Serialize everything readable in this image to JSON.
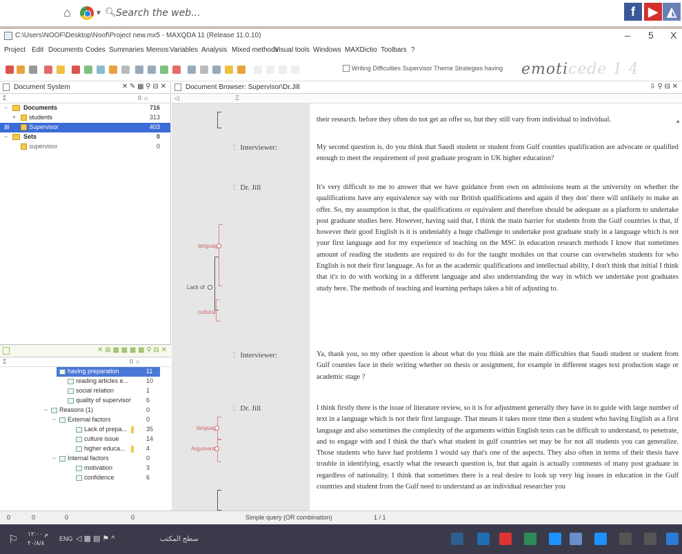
{
  "browser": {
    "search_placeholder": "Search the web..."
  },
  "window": {
    "title": "C:\\Users\\NOOF\\Desktop\\Noof\\Project new.mx5 - MAXQDA 11 (Release 11.0.10)",
    "minimize": "–",
    "restore": "5",
    "close": "X"
  },
  "menu": [
    "Project",
    "Edit",
    "Documents",
    "Codes",
    "Summaries",
    "Memos",
    "Variables",
    "Analysis",
    "Mixed methods",
    "Visual tools",
    "Windows",
    "MAXDictio",
    "Toolbars",
    "?"
  ],
  "toolbar": {
    "strategies_label": "Writing Difficulties Supervisor Theme Strategies having",
    "emoti_dark": "emoti",
    "emoti_faded": "cede 1 4"
  },
  "document_system": {
    "title": "Document System",
    "sub_left": "Σ",
    "sub_right": "0 ☼",
    "rows": [
      {
        "name": "Documents",
        "count": "716",
        "twisty": "−"
      },
      {
        "name": "students",
        "count": "313",
        "twisty": "+"
      },
      {
        "name": "Supervisor",
        "count": "403",
        "twisty": "⊞"
      },
      {
        "name": "Sets",
        "count": "0",
        "twisty": "−"
      },
      {
        "name": "supervisor",
        "count": "0",
        "twisty": ""
      }
    ]
  },
  "code_system": {
    "sub_left": "Σ",
    "sub_right": "0 ☼",
    "rows": [
      {
        "name": "having preparation",
        "count": "11",
        "twisty": ""
      },
      {
        "name": "reading articles e...",
        "count": "10",
        "twisty": ""
      },
      {
        "name": "social relation",
        "count": "1",
        "twisty": ""
      },
      {
        "name": "quality of supervisor",
        "count": "6",
        "twisty": ""
      },
      {
        "name": "Reasons (1)",
        "count": "0",
        "twisty": "−"
      },
      {
        "name": "External factors",
        "count": "0",
        "twisty": "−"
      },
      {
        "name": "Lack of prepa...",
        "count": "35",
        "twisty": ""
      },
      {
        "name": "culture issue",
        "count": "14",
        "twisty": ""
      },
      {
        "name": "higher educa...",
        "count": "4",
        "twisty": ""
      },
      {
        "name": "Internal factors",
        "count": "0",
        "twisty": "−"
      },
      {
        "name": "motivation",
        "count": "3",
        "twisty": ""
      },
      {
        "name": "confidence",
        "count": "6",
        "twisty": ""
      }
    ]
  },
  "browser_pane": {
    "title": "Document Browser: Supervisor\\Dr.Jill",
    "sub_left": "◁",
    "sub_mid": "Ξ"
  },
  "transcript": {
    "p0": "their research. before they often do not get an offer so, but they still vary from individual to individual.",
    "s1": "Interviewer:",
    "p1": "My second question is, do you think that Saudi student or student from Gulf counties qualification are advocate or qualified enough to meet the requirement of post graduate program in UK higher education?",
    "s2": "Dr. Jill",
    "p2": "It's very difficult to me to answer that we have guidance from own on admissions team at the university on whether the qualifications have any equivalence say with our British qualifications and again if they don' there will unlikely to make an offer. So, my assumption is that, the qualifications or equivalent and therefore should be adequate as a platform to undertake post graduate studies here. However, having said that, I think the main barrier for students from the Gulf countries is that, if however their good English is it is undeniably a huge challenge to undertake post graduate study in a language which is not your first language and for my experience of teaching on the MSC in education research methods I know that sometimes amount of reading the students are required to do for the taught modules on that course can overwhelm students for who English is not their first language. As for as the academic qualifications and intellectual ability, I don't think that initial I think that it's to do with working in a different language and also understanding the way in which we undertake post graduates study here. The methods of teaching and learning perhaps takes a bit of adjusting to.",
    "s3": "Interviewer:",
    "p3": "Ya, thank you, so my other question is about what do you think are the main difficulties that Saudi student or student from Gulf counties face in their writing whether on thesis or assignment, for example in different stages text production stage or academic stage ?",
    "s4": "Dr. Jill",
    "p4": "I think firstly there is the issue of literature review, so it is for adjustment generally they have in to guide with large number of text in a language which is not their first language. That means it takes more time then a student who having English as a first language and also sometimes the complexity of the arguments within English texts can be difficult to understand, to penetrate, and to engage with and I think the that's what student in gulf countries set may be for not all students you can generalize. Those students who have had problems I would say that's one of the aspects. They also often in terms of their thesis have trouble in identifying, exactly what the research question is, but that again is actually comments of many post graduate in regardless of nationality. I think that sometimes there is a real desire to look up very big issues in education in the Gulf countries and student from the Gulf need to understand as an individual researcher you",
    "code_marks": {
      "m1": "language",
      "m2": "Lack of",
      "m3": "cultural",
      "m4": "language",
      "m5": "Argument"
    }
  },
  "status": {
    "s1": "0",
    "s2": "0",
    "s3": "0",
    "s4": "0",
    "query": "Simple query (OR combination)",
    "page": "1 / 1"
  },
  "taskbar": {
    "lang": "ENG",
    "clock_time": "۱۲:۰۰ م",
    "clock_date": "۲۰/۸/۸",
    "desktop_label": "سطح المكتب"
  },
  "colors": {
    "selection": "#3b6bd6",
    "folder": "#f2c94c",
    "taskbar": "#3a3a4a",
    "code_bracket": "#d88888"
  }
}
